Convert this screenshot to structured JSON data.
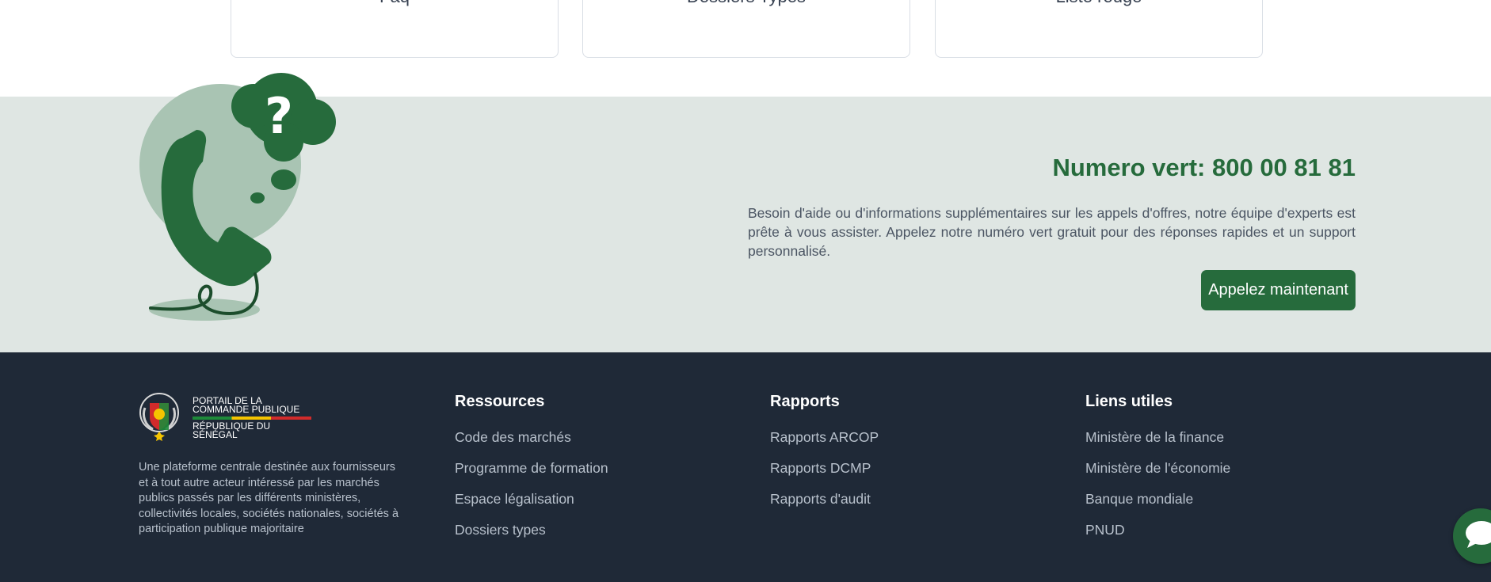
{
  "top_cards": [
    {
      "label": "Faq"
    },
    {
      "label": "Dossiers Types"
    },
    {
      "label": "Liste rouge"
    }
  ],
  "hotline": {
    "title": "Numero vert: 800 00 81 81",
    "description": "Besoin d'aide ou d'informations supplémentaires sur les appels d'offres, notre équipe d'experts est prête à vous assister. Appelez notre numéro vert gratuit pour des réponses rapides et un support personnalisé.",
    "button_label": "Appelez maintenant"
  },
  "footer": {
    "logo": {
      "line1": "PORTAIL DE LA",
      "line2": "COMMANDE PUBLIQUE",
      "line3": "RÉPUBLIQUE DU SÉNÉGAL"
    },
    "description": "Une plateforme centrale destinée aux fournisseurs et à tout autre acteur intéressé par les marchés publics passés par les différents ministères, collectivités locales, sociétés nationales, sociétés à participation publique majoritaire",
    "columns": [
      {
        "title": "Ressources",
        "links": [
          "Code des marchés",
          "Programme de formation",
          "Espace légalisation",
          "Dossiers types"
        ]
      },
      {
        "title": "Rapports",
        "links": [
          "Rapports ARCOP",
          "Rapports DCMP",
          "Rapports d'audit"
        ]
      },
      {
        "title": "Liens utiles",
        "links": [
          "Ministère de la finance",
          "Ministère de l'économie",
          "Banque mondiale",
          "PNUD"
        ]
      }
    ]
  },
  "icons": {
    "illustration": "phone-question-illustration",
    "chat": "chat-bubble-icon",
    "crest": "senegal-crest-icon"
  },
  "colors": {
    "brand_green": "#266b3c",
    "hotline_bg": "#dfe6e3",
    "footer_bg": "#1f2937"
  }
}
